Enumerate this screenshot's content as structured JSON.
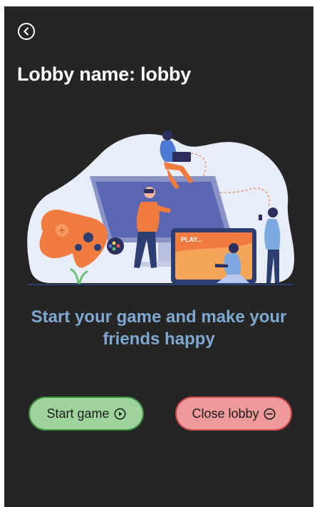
{
  "lobby": {
    "title": "Lobby name: lobby"
  },
  "illustration": {
    "screen_text": "PLAY..."
  },
  "tagline": "Start your game and make your friends happy",
  "actions": {
    "start_label": "Start game",
    "close_label": "Close lobby"
  },
  "colors": {
    "background": "#252525",
    "title": "#ffffff",
    "tagline": "#7ea8d0",
    "start_fill": "#9ed39c",
    "start_border": "#3c8a3f",
    "close_fill": "#ef9a9a",
    "close_border": "#c94a4a",
    "accent_orange": "#f07b3f"
  },
  "icons": {
    "back": "chevron-left-circle-icon",
    "start": "play-circle-icon",
    "close": "minus-circle-icon"
  }
}
